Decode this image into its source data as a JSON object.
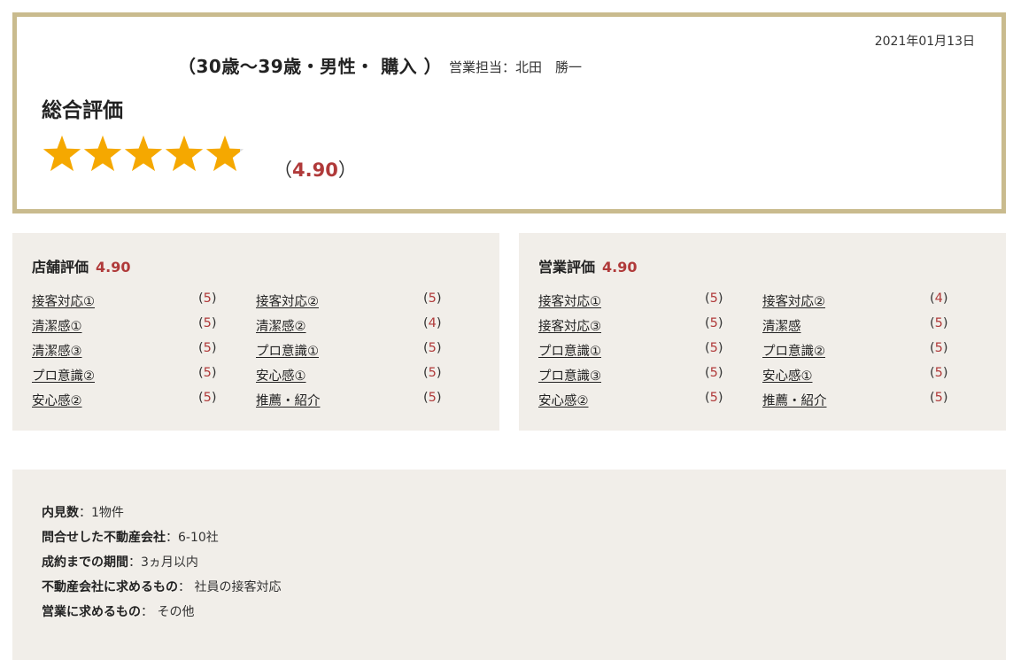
{
  "summary": {
    "date": "2021年01月13日",
    "profile": "（30歳〜39歳・男性・ 購入 ）",
    "rep_label": "営業担当：",
    "rep_name": "北田　勝一",
    "overall_title": "総合評価",
    "rating": 4.9,
    "star_count": 5,
    "score_open": "（",
    "score": "4.90",
    "score_close": "）",
    "star_color": "#f5a800"
  },
  "store": {
    "title": "店舗評価",
    "score": "4.90",
    "rows": [
      [
        {
          "label": "接客対応①",
          "score": "5"
        },
        {
          "label": "接客対応②",
          "score": "5"
        }
      ],
      [
        {
          "label": "清潔感①",
          "score": "5"
        },
        {
          "label": "清潔感②",
          "score": "4"
        }
      ],
      [
        {
          "label": "清潔感③",
          "score": "5"
        },
        {
          "label": "プロ意識①",
          "score": "5"
        }
      ],
      [
        {
          "label": "プロ意識②",
          "score": "5"
        },
        {
          "label": "安心感①",
          "score": "5"
        }
      ],
      [
        {
          "label": "安心感②",
          "score": "5"
        },
        {
          "label": "推薦・紹介",
          "score": "5"
        }
      ]
    ]
  },
  "sales": {
    "title": "営業評価",
    "score": "4.90",
    "rows": [
      [
        {
          "label": "接客対応①",
          "score": "5"
        },
        {
          "label": "接客対応②",
          "score": "4"
        }
      ],
      [
        {
          "label": "接客対応③",
          "score": "5"
        },
        {
          "label": "清潔感",
          "score": "5"
        }
      ],
      [
        {
          "label": "プロ意識①",
          "score": "5"
        },
        {
          "label": "プロ意識②",
          "score": "5"
        }
      ],
      [
        {
          "label": "プロ意識③",
          "score": "5"
        },
        {
          "label": "安心感①",
          "score": "5"
        }
      ],
      [
        {
          "label": "安心感②",
          "score": "5"
        },
        {
          "label": "推薦・紹介",
          "score": "5"
        }
      ]
    ]
  },
  "details": [
    {
      "key": "内見数",
      "sep": "：",
      "value": "1物件"
    },
    {
      "key": "問合せした不動産会社",
      "sep": "：",
      "value": "6-10社"
    },
    {
      "key": "成約までの期間",
      "sep": "：",
      "value": "3ヵ月以内"
    },
    {
      "key": "不動産会社に求めるもの",
      "sep": "： ",
      "value": "社員の接客対応"
    },
    {
      "key": "営業に求めるもの",
      "sep": "： ",
      "value": "その他"
    }
  ],
  "colors": {
    "border": "#c9bb8e",
    "panel_bg": "#f1eee9",
    "accent_score": "#b03a3a"
  }
}
